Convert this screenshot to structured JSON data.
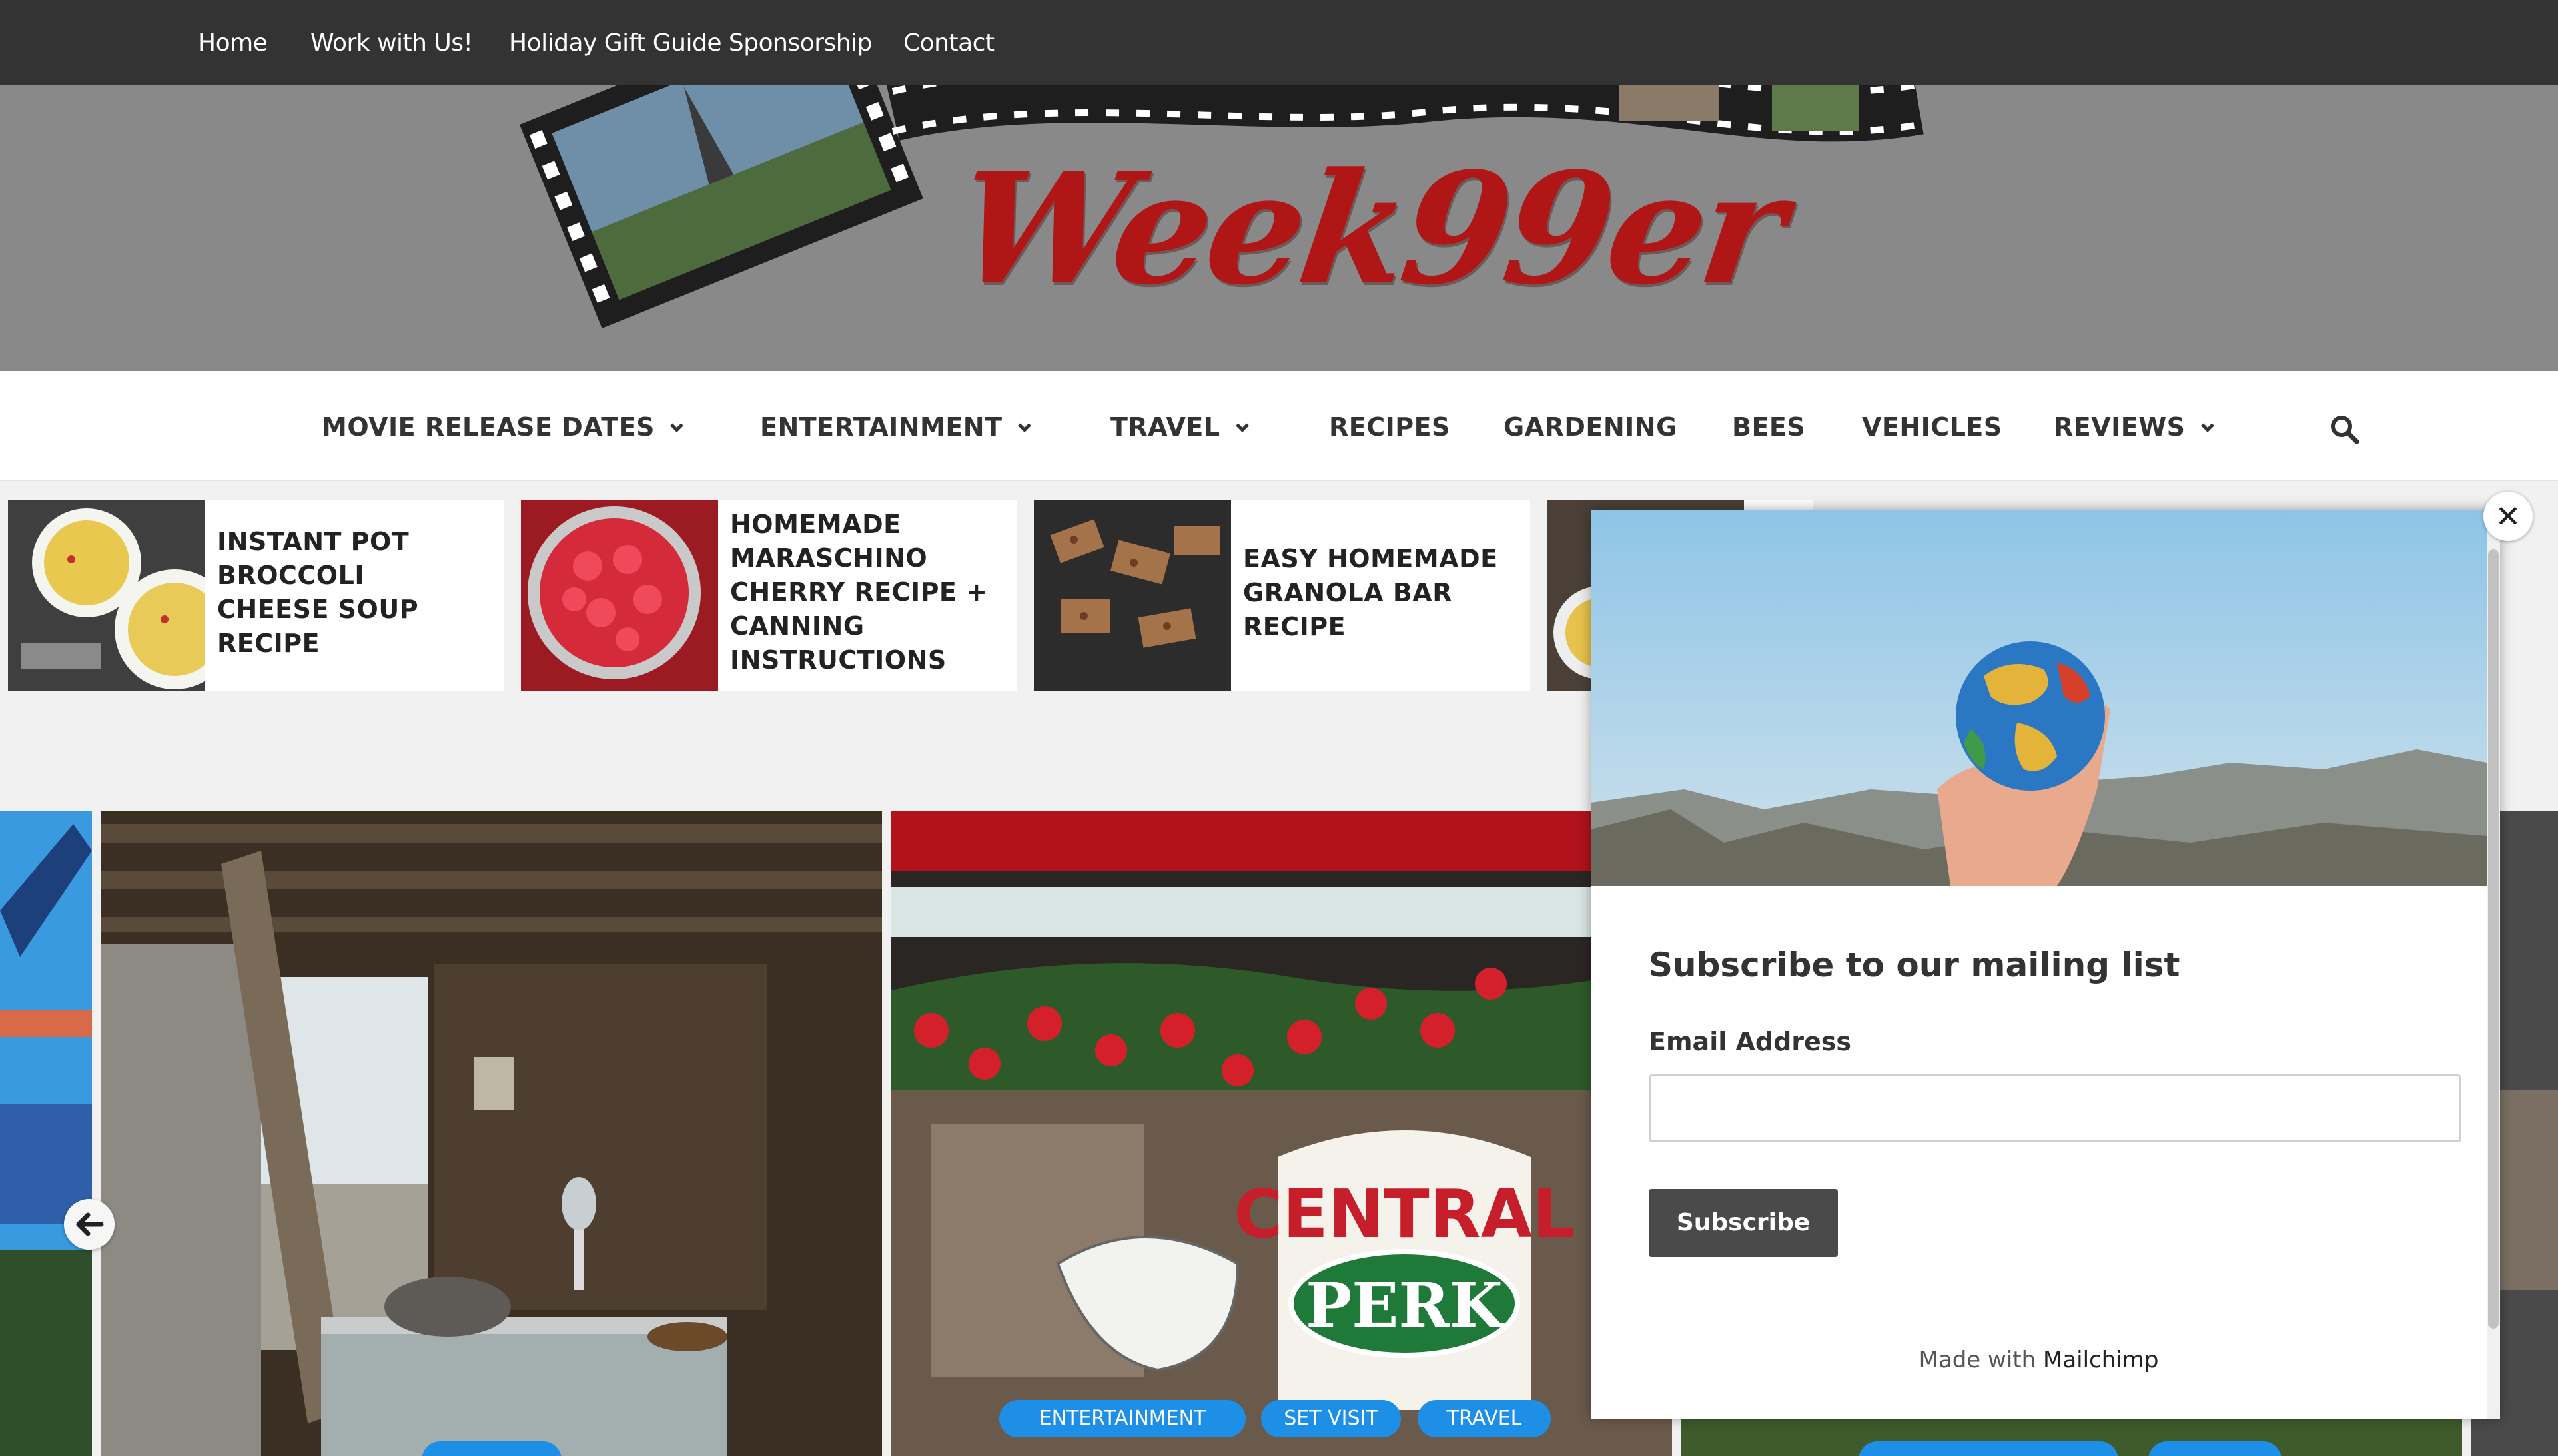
{
  "topbar": {
    "links": [
      "Home",
      "Work with Us!",
      "Holiday Gift Guide Sponsorship",
      "Contact"
    ]
  },
  "header": {
    "logo_text": "Week99er"
  },
  "nav": {
    "items": [
      {
        "label": "MOVIE RELEASE DATES",
        "dropdown": true
      },
      {
        "label": "ENTERTAINMENT",
        "dropdown": true
      },
      {
        "label": "TRAVEL",
        "dropdown": true
      },
      {
        "label": "RECIPES",
        "dropdown": false
      },
      {
        "label": "GARDENING",
        "dropdown": false
      },
      {
        "label": "BEES",
        "dropdown": false
      },
      {
        "label": "VEHICLES",
        "dropdown": false
      },
      {
        "label": "REVIEWS",
        "dropdown": true
      }
    ],
    "search_icon": "search-icon"
  },
  "recipe_strip": [
    {
      "title_lines": [
        "Instant Pot",
        "Broccoli",
        "Cheese Soup",
        "Recipe"
      ]
    },
    {
      "title_lines": [
        "Homemade",
        "Maraschino",
        "Cherry Recipe +",
        "Canning",
        "Instructions"
      ]
    },
    {
      "title_lines": [
        "Easy Homemade",
        "Granola Bar",
        "Recipe"
      ]
    }
  ],
  "slider": {
    "prev_icon": "arrow-left-icon",
    "slide2_tags": [
      "Entertainment",
      "Set Visit",
      "Travel"
    ],
    "slide2_sign": [
      "CENTRAL",
      "PERK"
    ]
  },
  "modal": {
    "title": "Subscribe to our mailing list",
    "email_label": "Email Address",
    "email_value": "",
    "subscribe_label": "Subscribe",
    "made_with_prefix": "Made with",
    "made_with_brand": "Mailchimp",
    "close_glyph": "✕"
  },
  "colors": {
    "topbar": "#333333",
    "logo_red": "#b01616",
    "tag_blue": "#1e8fe6",
    "button_dark": "#4a4a4a"
  }
}
